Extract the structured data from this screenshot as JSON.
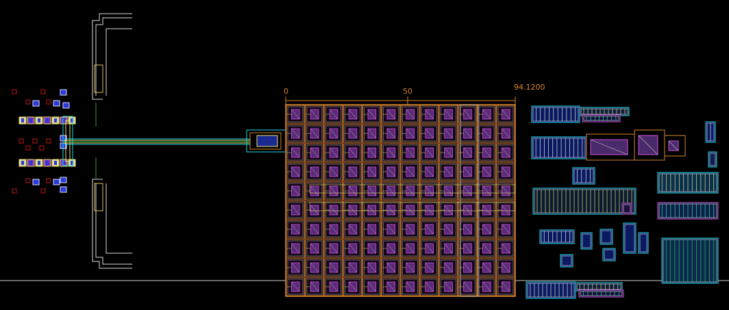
{
  "view": {
    "background": "#000000",
    "ruler": {
      "labels": [
        "0",
        "50",
        "94.1200"
      ],
      "color": "#d8862a"
    }
  },
  "colors": {
    "orange": "#d8862a",
    "white": "#e6e6e6",
    "gray": "#9a9a9a",
    "cyan": "#22d8e8",
    "yellow": "#e8e070",
    "magenta": "#d050e0",
    "blue": "#2a3ad8",
    "purple": "#8030c0",
    "red": "#c01818",
    "green": "#30c050",
    "pink": "#f070c0"
  },
  "layers": {
    "axis_line": "horizontal-baseline",
    "array": {
      "rows": 10,
      "cols": 12
    }
  }
}
